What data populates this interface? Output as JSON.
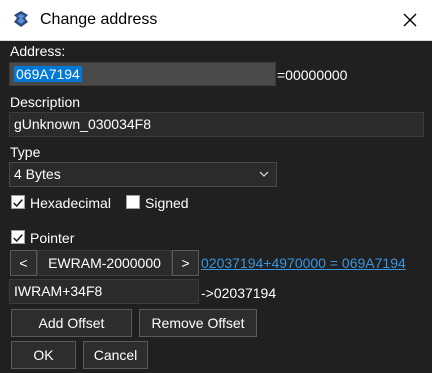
{
  "window": {
    "title": "Change address"
  },
  "address": {
    "label": "Address:",
    "value": "069A7194",
    "resolved": "=00000000"
  },
  "description": {
    "label": "Description",
    "value": "gUnknown_030034F8"
  },
  "type": {
    "label": "Type",
    "selected": "4 Bytes"
  },
  "options": {
    "hexadecimal": {
      "label": "Hexadecimal",
      "checked": true
    },
    "signed": {
      "label": "Signed",
      "checked": false
    }
  },
  "pointer": {
    "label": "Pointer",
    "checked": true,
    "prev_label": "<",
    "base_value": "EWRAM-2000000",
    "next_label": ">",
    "calc_link": "02037194+4970000 = 069A7194",
    "offset_value": "IWRAM+34F8",
    "offset_result": "->02037194"
  },
  "buttons": {
    "add_offset": "Add Offset",
    "remove_offset": "Remove Offset",
    "ok": "OK",
    "cancel": "Cancel"
  },
  "colors": {
    "background": "#202020",
    "selection": "#0078d7",
    "link": "#3a96e0"
  }
}
